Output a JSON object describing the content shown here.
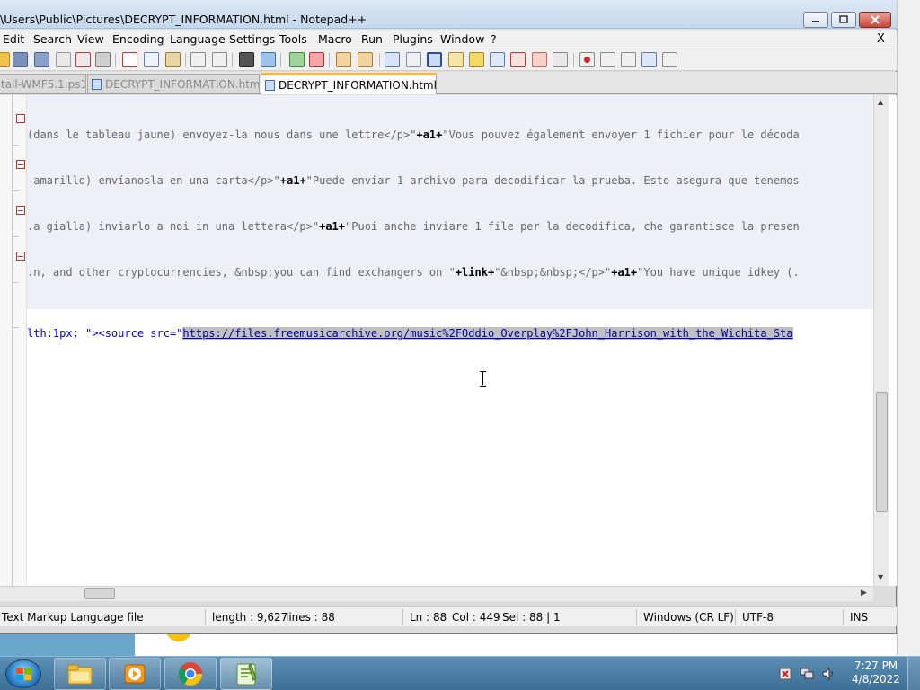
{
  "window": {
    "title": "\\Users\\Public\\Pictures\\DECRYPT_INFORMATION.html - Notepad++"
  },
  "menu": {
    "items": [
      "Edit",
      "Search",
      "View",
      "Encoding",
      "Language",
      "Settings",
      "Tools",
      "Macro",
      "Run",
      "Plugins",
      "Window",
      "?"
    ],
    "close_label": "X"
  },
  "tabs": [
    {
      "label": "tall-WMF5.1.ps1",
      "active": false
    },
    {
      "label": "DECRYPT_INFORMATION.html",
      "active": false
    },
    {
      "label": "DECRYPT_INFORMATION.html",
      "active": true
    }
  ],
  "editor": {
    "lines": [
      {
        "pre": "(dans le tableau jaune) envoyez-la nous dans une lettre</p>\"",
        "var": "+a1+",
        "post": "\"Vous pouvez également envoyer 1 fichier pour le décoda"
      },
      {
        "pre": " amarillo) envíanosla en una carta</p>\"",
        "var": "+a1+",
        "post": "\"Puede enviar 1 archivo para decodificar la prueba. Esto asegura que tenemos"
      },
      {
        "pre": ".a gialla) inviarlo a noi in una lettera</p>\"",
        "var": "+a1+",
        "post": "\"Puoi anche inviare 1 file per la decodifica, che garantisce la presen"
      },
      {
        "pre": ".n, and other cryptocurrencies, &nbsp;you can find exchangers on \"",
        "var": "+link+",
        "mid": "\"&nbsp;&nbsp;</p>\"",
        "var2": "+a1+",
        "post": "\"You have unique idkey (."
      },
      {
        "pre": "lth:1px; \"><source src=\"",
        "link": "https://files.freemusicarchive.org/music%2FOddio_Overplay%2FJohn_Harrison_with_the_Wichita_Sta"
      }
    ]
  },
  "status": {
    "filetype": "Text Markup Language file",
    "length": "length : 9,627",
    "lines": "lines : 88",
    "ln": "Ln : 88",
    "col": "Col : 449",
    "sel": "Sel : 88 | 1",
    "eol": "Windows (CR LF)",
    "encoding": "UTF-8",
    "mode": "INS"
  },
  "taskbar": {
    "clock_time": "7:27 PM",
    "clock_date": "4/8/2022"
  },
  "colors": {
    "tab_active_accent": "#f6b544",
    "code_blue": "#0000ff",
    "fold_red": "#c03030"
  }
}
